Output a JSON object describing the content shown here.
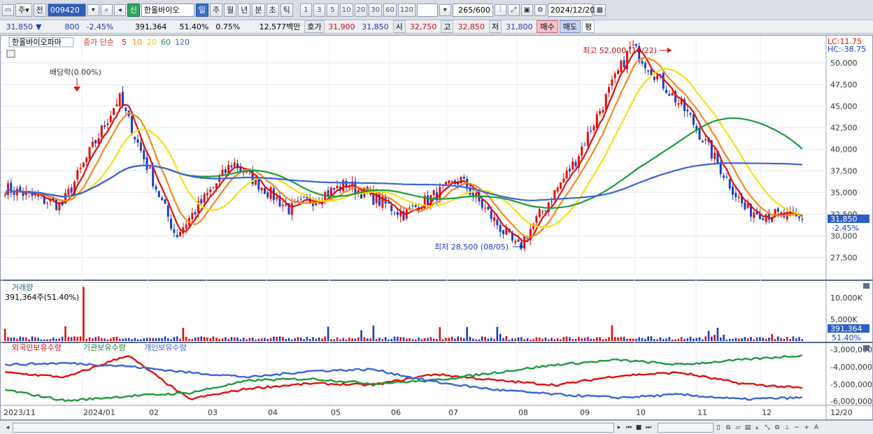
{
  "toolbar": {
    "ju_label": "주",
    "jeon_label": "전",
    "stock_code": "009420",
    "shin_label": "신",
    "stock_name": "한올바이오",
    "periods": [
      "일",
      "주",
      "월",
      "년",
      "분",
      "초",
      "틱"
    ],
    "selected_period": "일",
    "intervals": [
      "1",
      "3",
      "5",
      "10",
      "20",
      "30",
      "60",
      "120"
    ],
    "count_value": "265",
    "count_total": "/600",
    "date": "2024/12/20"
  },
  "quote": {
    "price": "31,850",
    "arrow": "▼",
    "change": "800",
    "change_pct": "-2.45%",
    "volume": "391,364",
    "volume_ratio": "51.40%",
    "turnover": "0.75%",
    "amount": "12,577백만",
    "hoga_label": "호가",
    "hoga_ask": "31,900",
    "hoga_bid": "31,850",
    "open_label": "시",
    "open": "32,750",
    "high_label": "고",
    "high": "32,850",
    "low_label": "저",
    "low": "31,800",
    "buy_label": "매수",
    "sell_label": "매도",
    "eval_label": "평"
  },
  "legend": {
    "stock_name": "한올바이오파마",
    "ma_prefix": "종가 단순",
    "ma_periods": [
      "5",
      "10",
      "20",
      "60",
      "120"
    ],
    "lc": "LC:11.75",
    "hc": "HC:-38.75"
  },
  "annotations": {
    "dividend": "배당락(0.00%)",
    "high": "최고 52,000 (10/22)",
    "low": "최저 28,500 (08/05)"
  },
  "price_axis": [
    "50,000",
    "47,500",
    "45,000",
    "42,500",
    "40,000",
    "37,500",
    "35,000",
    "32,500",
    "30,000",
    "27,500"
  ],
  "price_marker": {
    "price": "31,850",
    "pct": "-2.45%"
  },
  "volume_panel": {
    "title": "거래량",
    "value": "391,364주(51.40%)",
    "axis": [
      "10,000K",
      "5,000K"
    ],
    "marker_value": "391,364",
    "marker_pct": "51.40%"
  },
  "holdings_panel": {
    "series_names": [
      "외국인보유수량",
      "기관보유수량",
      "개인보유수량"
    ],
    "axis": [
      "-3,000,000",
      "-4,000,000",
      "-5,000,000",
      "-6,000,000"
    ]
  },
  "x_axis": [
    "2023/11",
    "2024/01",
    "02",
    "03",
    "04",
    "05",
    "06",
    "07",
    "08",
    "09",
    "10",
    "11",
    "12",
    "12/20"
  ],
  "colors": {
    "ma5": "#e01010",
    "ma10": "#f08a1c",
    "ma20": "#f5e014",
    "ma60": "#1f9a3a",
    "ma120": "#3a64d8",
    "up": "#e01010",
    "down": "#1a3fc0"
  },
  "chart_data": [
    {
      "type": "candlestick",
      "title": "한올바이오파마",
      "ylim": [
        25500,
        52500
      ],
      "key_points": [
        {
          "date": "2023/11",
          "close": 35500
        },
        {
          "date": "2023/12",
          "close": 33500
        },
        {
          "date": "2024/01",
          "close": 46000
        },
        {
          "date": "2024/02",
          "close": 30000
        },
        {
          "date": "2024/03",
          "close": 38500
        },
        {
          "date": "2024/04",
          "close": 33000
        },
        {
          "date": "2024/05",
          "close": 36000
        },
        {
          "date": "2024/06",
          "close": 32500
        },
        {
          "date": "2024/07",
          "close": 36500
        },
        {
          "date": "2024/08",
          "close": 28500
        },
        {
          "date": "2024/09",
          "close": 38500
        },
        {
          "date": "2024/10",
          "close": 52000
        },
        {
          "date": "2024/11",
          "close": 44000
        },
        {
          "date": "2024/12",
          "close": 33000
        },
        {
          "date": "2024/12/20",
          "close": 31850
        }
      ],
      "series": [
        {
          "name": "5",
          "type": "line",
          "color": "#e01010"
        },
        {
          "name": "10",
          "type": "line",
          "color": "#f08a1c"
        },
        {
          "name": "20",
          "type": "line",
          "color": "#f5e014"
        },
        {
          "name": "60",
          "type": "line",
          "color": "#1f9a3a"
        },
        {
          "name": "120",
          "type": "line",
          "color": "#3a64d8"
        }
      ],
      "annotations": [
        {
          "text": "배당락(0.00%)",
          "date": "2023/12",
          "value": 46500
        },
        {
          "text": "최고 52,000 (10/22)",
          "date": "2024/10/22",
          "value": 52000
        },
        {
          "text": "최저 28,500 (08/05)",
          "date": "2024/08/05",
          "value": 28500
        }
      ]
    },
    {
      "type": "bar",
      "title": "거래량",
      "ylim": [
        0,
        12000000
      ],
      "key_points": [
        {
          "date": "2023/12",
          "volume": 11500000
        },
        {
          "date": "2024/12/20",
          "volume": 391364
        }
      ]
    },
    {
      "type": "line",
      "title": "보유수량",
      "ylim": [
        -6300000,
        -2700000
      ],
      "series": [
        {
          "name": "외국인보유수량",
          "color": "#e01010",
          "approx": [
            -4300000,
            -4600000,
            -3200000,
            -6000000,
            -5300000,
            -5000000,
            -5100000,
            -4400000,
            -4800000,
            -5100000,
            -4500000,
            -4300000,
            -5000000,
            -5300000
          ]
        },
        {
          "name": "기관보유수량",
          "color": "#1f9a3a",
          "approx": [
            -5400000,
            -6100000,
            -5800000,
            -5600000,
            -4800000,
            -4700000,
            -5000000,
            -4800000,
            -4300000,
            -3800000,
            -3500000,
            -3800000,
            -3500000,
            -3200000
          ]
        },
        {
          "name": "개인보유수량",
          "color": "#3a64d8",
          "approx": [
            -3800000,
            -3700000,
            -3900000,
            -4300000,
            -4600000,
            -4200000,
            -4100000,
            -4900000,
            -5400000,
            -5700000,
            -5900000,
            -5700000,
            -6000000,
            -5900000
          ]
        }
      ]
    }
  ]
}
